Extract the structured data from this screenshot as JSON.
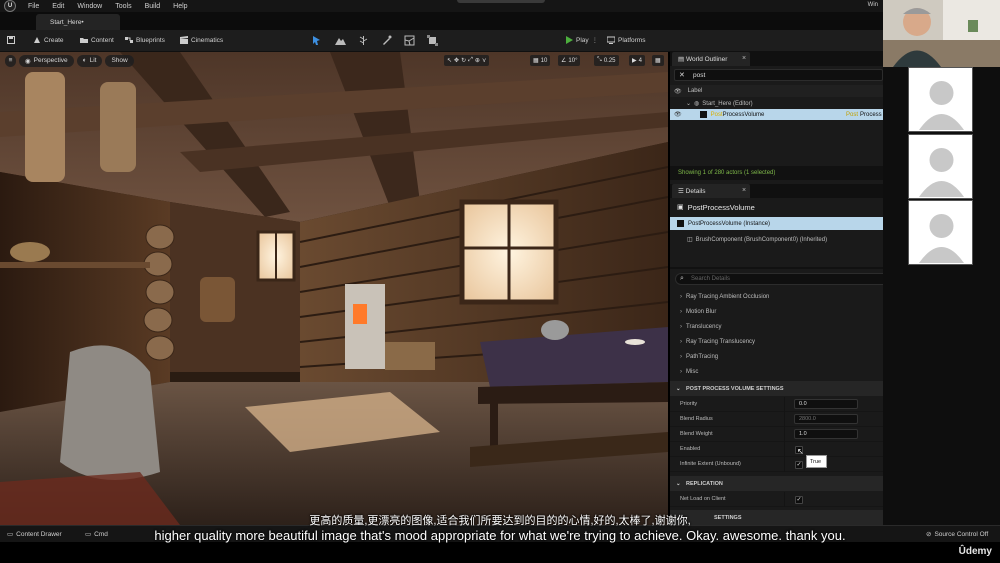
{
  "menu": {
    "items": [
      "File",
      "Edit",
      "Window",
      "Tools",
      "Build",
      "Help"
    ],
    "window_title": "Win"
  },
  "tabs": {
    "level": "Start_Here•"
  },
  "toolbar": {
    "create": "Create",
    "content": "Content",
    "blueprints": "Blueprints",
    "cinematics": "Cinematics",
    "play": "Play",
    "platforms": "Platforms"
  },
  "viewport": {
    "perspective": "Perspective",
    "lit": "Lit",
    "show": "Show",
    "grid_snap": "10",
    "rot_snap": "10°",
    "scale_snap": "0.25",
    "camera_speed": "4"
  },
  "outliner": {
    "tab": "World Outliner",
    "search": "post",
    "column_label": "Label",
    "root": "Start_Here (Editor)",
    "item_highlight": "Post",
    "item_rest": "ProcessVolume",
    "item_type_highlight": "Post",
    "item_type_rest": "Process",
    "status": "Showing 1 of 280 actors (1 selected)"
  },
  "details": {
    "tab": "Details",
    "actor_name": "PostProcessVolume",
    "instance": "PostProcessVolume (Instance)",
    "component": "BrushComponent (BrushComponent0) (Inherited)",
    "search_placeholder": "Search Details",
    "collapsed_sections": [
      "Ray Tracing Ambient Occlusion",
      "Motion Blur",
      "Translucency",
      "Ray Tracing Translucency",
      "PathTracing",
      "Misc"
    ],
    "section_ppv": "POST PROCESS VOLUME SETTINGS",
    "priority_label": "Priority",
    "priority_value": "0.0",
    "blend_radius_label": "Blend Radius",
    "blend_radius_value": "2800.0",
    "blend_weight_label": "Blend Weight",
    "blend_weight_value": "1.0",
    "enabled_label": "Enabled",
    "infinite_label": "Infinite Extent (Unbound)",
    "tooltip": "True",
    "section_replication": "REPLICATION",
    "net_load_label": "Net Load on Client",
    "partial_section": "SETTINGS"
  },
  "statusbar": {
    "content_drawer": "Content Drawer",
    "cmd": "Cmd",
    "source_control": "Source Control Off"
  },
  "subtitles": {
    "cn": "更高的质量,更漂亮的图像,适合我们所要达到的目的的心情,好的,太棒了,谢谢你,",
    "en": "higher quality more beautiful image that's mood appropriate for what we're trying to achieve. Okay. awesome. thank you."
  },
  "brand": "Ûdemy"
}
